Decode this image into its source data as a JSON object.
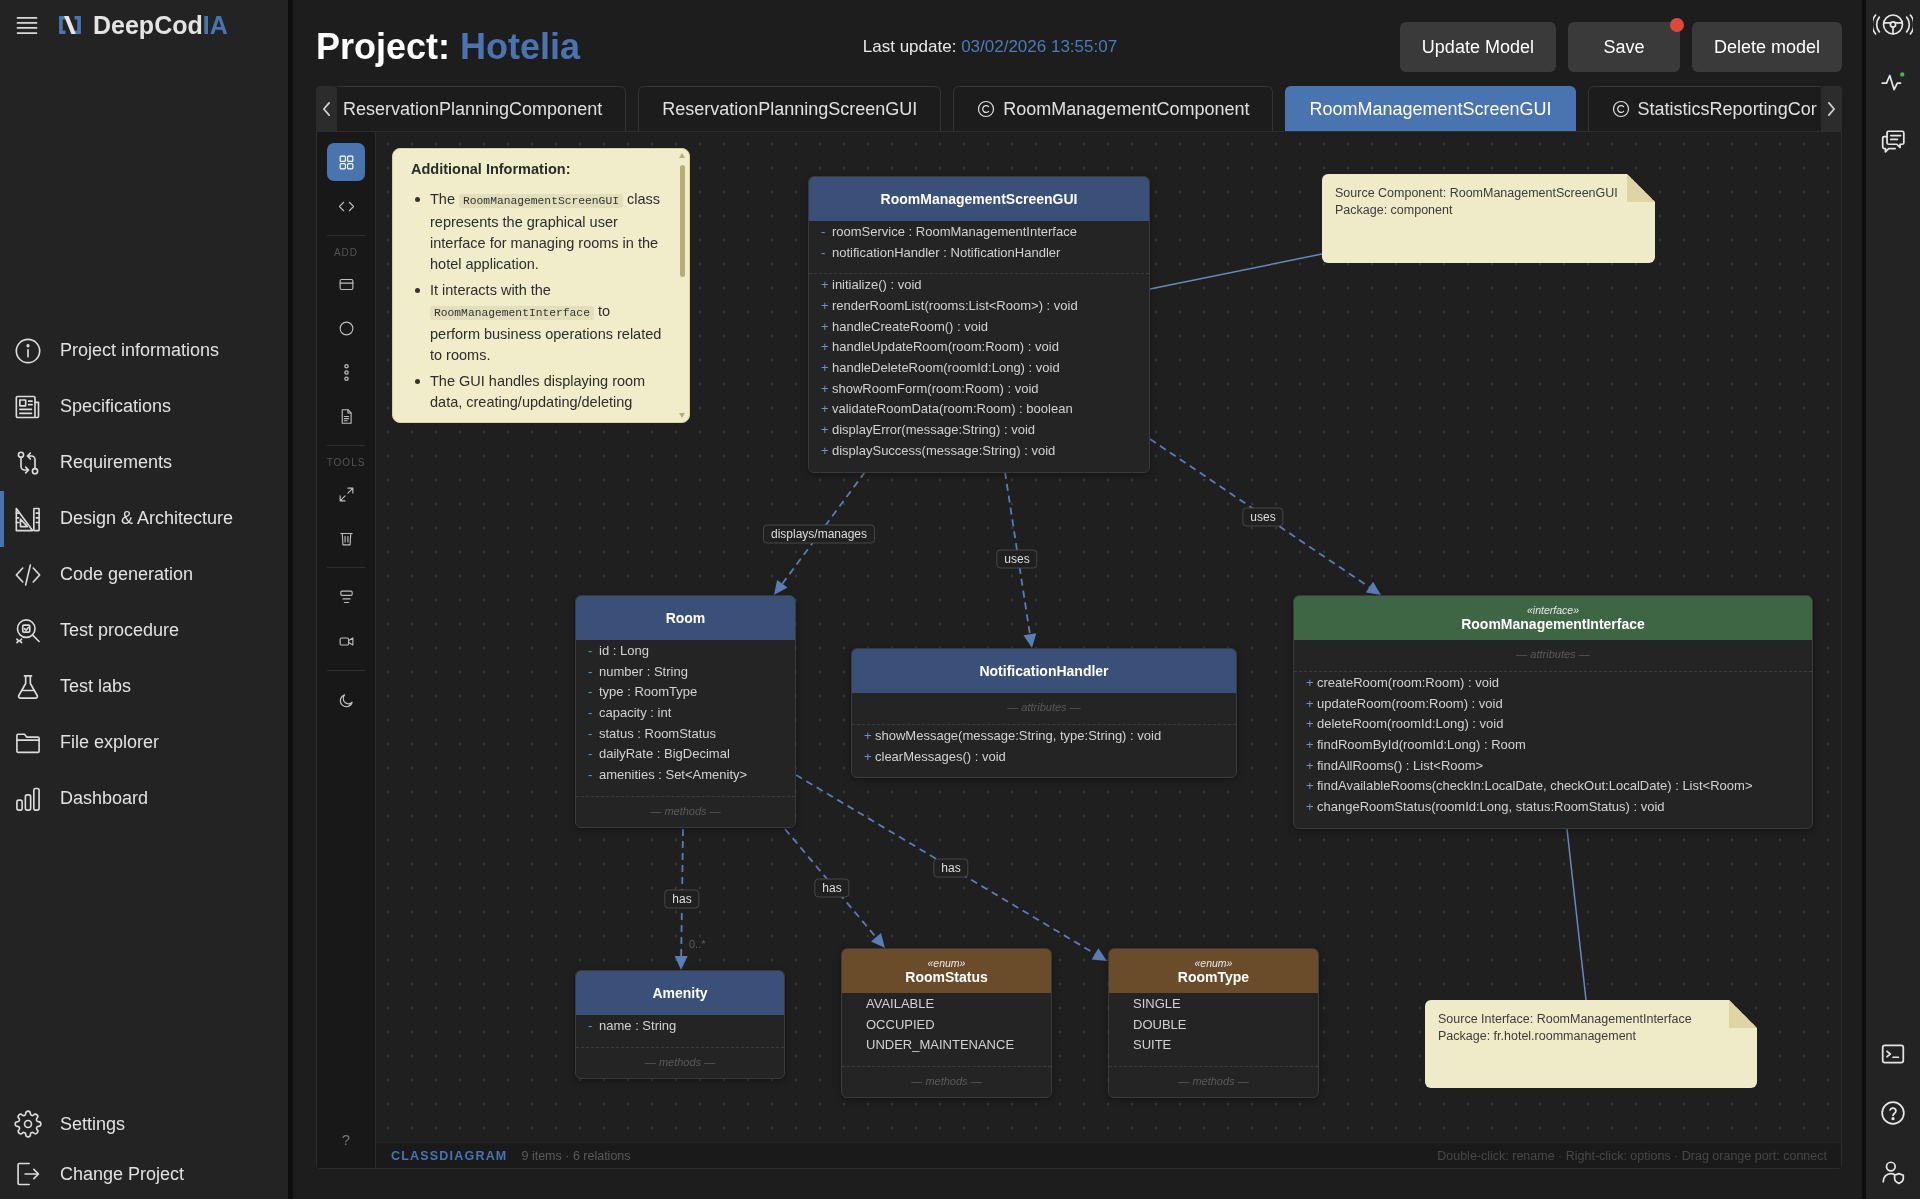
{
  "sidebar": {
    "brand": {
      "name": "DeepCod",
      "accent": "IA"
    },
    "items": [
      {
        "label": "Project informations",
        "selected": false
      },
      {
        "label": "Specifications",
        "selected": false
      },
      {
        "label": "Requirements",
        "selected": false
      },
      {
        "label": "Design & Architecture",
        "selected": true
      },
      {
        "label": "Code generation",
        "selected": false
      },
      {
        "label": "Test procedure",
        "selected": false
      },
      {
        "label": "Test labs",
        "selected": false
      },
      {
        "label": "File explorer",
        "selected": false
      },
      {
        "label": "Dashboard",
        "selected": false
      }
    ],
    "footer_items": [
      {
        "label": "Settings",
        "selected": false
      },
      {
        "label": "Change Project",
        "selected": false
      }
    ]
  },
  "header": {
    "project_label": "Project:",
    "project_name": "Hotelia",
    "last_update_label": "Last update:",
    "last_update_value": "03/02/2026 13:55:07",
    "buttons": [
      {
        "label": "Update Model",
        "unsaved": false
      },
      {
        "label": "Save",
        "unsaved": true
      },
      {
        "label": "Delete model",
        "unsaved": false
      }
    ]
  },
  "tabs": [
    {
      "label": "ReservationPlanningComponent",
      "kind": "plain",
      "selected": false
    },
    {
      "label": "ReservationPlanningScreenGUI",
      "kind": "plain",
      "selected": false
    },
    {
      "label": "RoomManagementComponent",
      "kind": "component",
      "selected": false
    },
    {
      "label": "RoomManagementScreenGUI",
      "kind": "plain",
      "selected": true
    },
    {
      "label": "StatisticsReportingCor",
      "kind": "component",
      "selected": false
    }
  ],
  "toolbar": {
    "groups": [
      {
        "items": [
          {
            "selected": true
          },
          {
            "selected": false
          }
        ]
      },
      {
        "label": "ADD",
        "items": [
          {
            "selected": false
          },
          {
            "selected": false
          },
          {
            "selected": false
          },
          {
            "selected": false
          }
        ]
      },
      {
        "label": "TOOLS",
        "items": [
          {
            "selected": false
          },
          {
            "selected": false
          }
        ]
      },
      {
        "items": [
          {
            "selected": false
          },
          {
            "selected": false
          }
        ]
      },
      {
        "items": [
          {
            "selected": false
          }
        ]
      }
    ],
    "help": "?"
  },
  "diagram": {
    "nodes": [
      {
        "kind": "info_note",
        "title": "Additional Information:",
        "bullets": [
          {
            "parts": [
              {
                "kind": "text",
                "text": "The "
              },
              {
                "kind": "code",
                "text": "RoomManagementScreenGUI"
              },
              {
                "kind": "text",
                "text": " class represents the graphical user interface for managing rooms in the hotel application."
              }
            ]
          },
          {
            "parts": [
              {
                "kind": "text",
                "text": "It interacts with the "
              },
              {
                "kind": "code",
                "text": "RoomManagementInterface"
              },
              {
                "kind": "text",
                "text": " to perform business operations related to rooms."
              }
            ]
          },
          {
            "parts": [
              {
                "kind": "text",
                "text": "The GUI handles displaying room data, creating/updating/deleting"
              }
            ]
          }
        ]
      },
      {
        "kind": "class",
        "name": "RoomManagementScreenGUI",
        "attributes": [
          {
            "visibility": "-",
            "text": "roomService : RoomManagementInterface"
          },
          {
            "visibility": "-",
            "text": "notificationHandler : NotificationHandler"
          }
        ],
        "methods": [
          {
            "visibility": "+",
            "text": "initialize() : void"
          },
          {
            "visibility": "+",
            "text": "renderRoomList(rooms:List<Room>) : void"
          },
          {
            "visibility": "+",
            "text": "handleCreateRoom() : void"
          },
          {
            "visibility": "+",
            "text": "handleUpdateRoom(room:Room) : void"
          },
          {
            "visibility": "+",
            "text": "handleDeleteRoom(roomId:Long) : void"
          },
          {
            "visibility": "+",
            "text": "showRoomForm(room:Room) : void"
          },
          {
            "visibility": "+",
            "text": "validateRoomData(room:Room) : boolean"
          },
          {
            "visibility": "+",
            "text": "displayError(message:String) : void"
          },
          {
            "visibility": "+",
            "text": "displaySuccess(message:String) : void"
          }
        ]
      },
      {
        "kind": "note",
        "lines": [
          "Source Component: RoomManagementScreenGUI",
          "Package: component"
        ]
      },
      {
        "kind": "class",
        "name": "Room",
        "attributes": [
          {
            "visibility": "-",
            "text": "id : Long"
          },
          {
            "visibility": "-",
            "text": "number : String"
          },
          {
            "visibility": "-",
            "text": "type : RoomType"
          },
          {
            "visibility": "-",
            "text": "capacity : int"
          },
          {
            "visibility": "-",
            "text": "status : RoomStatus"
          },
          {
            "visibility": "-",
            "text": "dailyRate : BigDecimal"
          },
          {
            "visibility": "-",
            "text": "amenities : Set<Amenity>"
          }
        ],
        "empty_methods": "— methods —"
      },
      {
        "kind": "class",
        "name": "NotificationHandler",
        "empty_attributes": "— attributes —",
        "methods": [
          {
            "visibility": "+",
            "text": "showMessage(message:String, type:String) : void"
          },
          {
            "visibility": "+",
            "text": "clearMessages() : void"
          }
        ]
      },
      {
        "kind": "interface",
        "stereotype": "«interface»",
        "name": "RoomManagementInterface",
        "empty_attributes": "— attributes —",
        "methods": [
          {
            "visibility": "+",
            "text": "createRoom(room:Room) : void"
          },
          {
            "visibility": "+",
            "text": "updateRoom(room:Room) : void"
          },
          {
            "visibility": "+",
            "text": "deleteRoom(roomId:Long) : void"
          },
          {
            "visibility": "+",
            "text": "findRoomById(roomId:Long) : Room"
          },
          {
            "visibility": "+",
            "text": "findAllRooms() : List<Room>"
          },
          {
            "visibility": "+",
            "text": "findAvailableRooms(checkIn:LocalDate, checkOut:LocalDate) : List<Room>"
          },
          {
            "visibility": "+",
            "text": "changeRoomStatus(roomId:Long, status:RoomStatus) : void"
          }
        ]
      },
      {
        "kind": "class",
        "name": "Amenity",
        "attributes": [
          {
            "visibility": "-",
            "text": "name : String"
          }
        ],
        "empty_methods": "— methods —"
      },
      {
        "kind": "enum",
        "stereotype": "«enum»",
        "name": "RoomStatus",
        "values": [
          "AVAILABLE",
          "OCCUPIED",
          "UNDER_MAINTENANCE"
        ],
        "empty_methods": "— methods —"
      },
      {
        "kind": "enum",
        "stereotype": "«enum»",
        "name": "RoomType",
        "values": [
          "SINGLE",
          "DOUBLE",
          "SUITE"
        ],
        "empty_methods": "— methods —"
      },
      {
        "kind": "note",
        "lines": [
          "Source Interface: RoomManagementInterface",
          "Package: fr.hotel.roommanagement"
        ]
      }
    ],
    "connections": [
      {
        "kind": "dependency",
        "label": "displays/manages"
      },
      {
        "kind": "dependency",
        "label": "uses"
      },
      {
        "kind": "dependency",
        "label": "uses"
      },
      {
        "kind": "dependency",
        "label": "has",
        "multiplicity": "0..*"
      },
      {
        "kind": "dependency",
        "label": "has"
      },
      {
        "kind": "dependency",
        "label": "has"
      },
      {
        "kind": "note_link"
      },
      {
        "kind": "note_link"
      }
    ]
  },
  "status_bar": {
    "mode": "CLASSDIAGRAM",
    "summary": "9 items · 6 relations",
    "hints": "Double-click: rename · Right-click: options · Drag orange port: connect"
  }
}
